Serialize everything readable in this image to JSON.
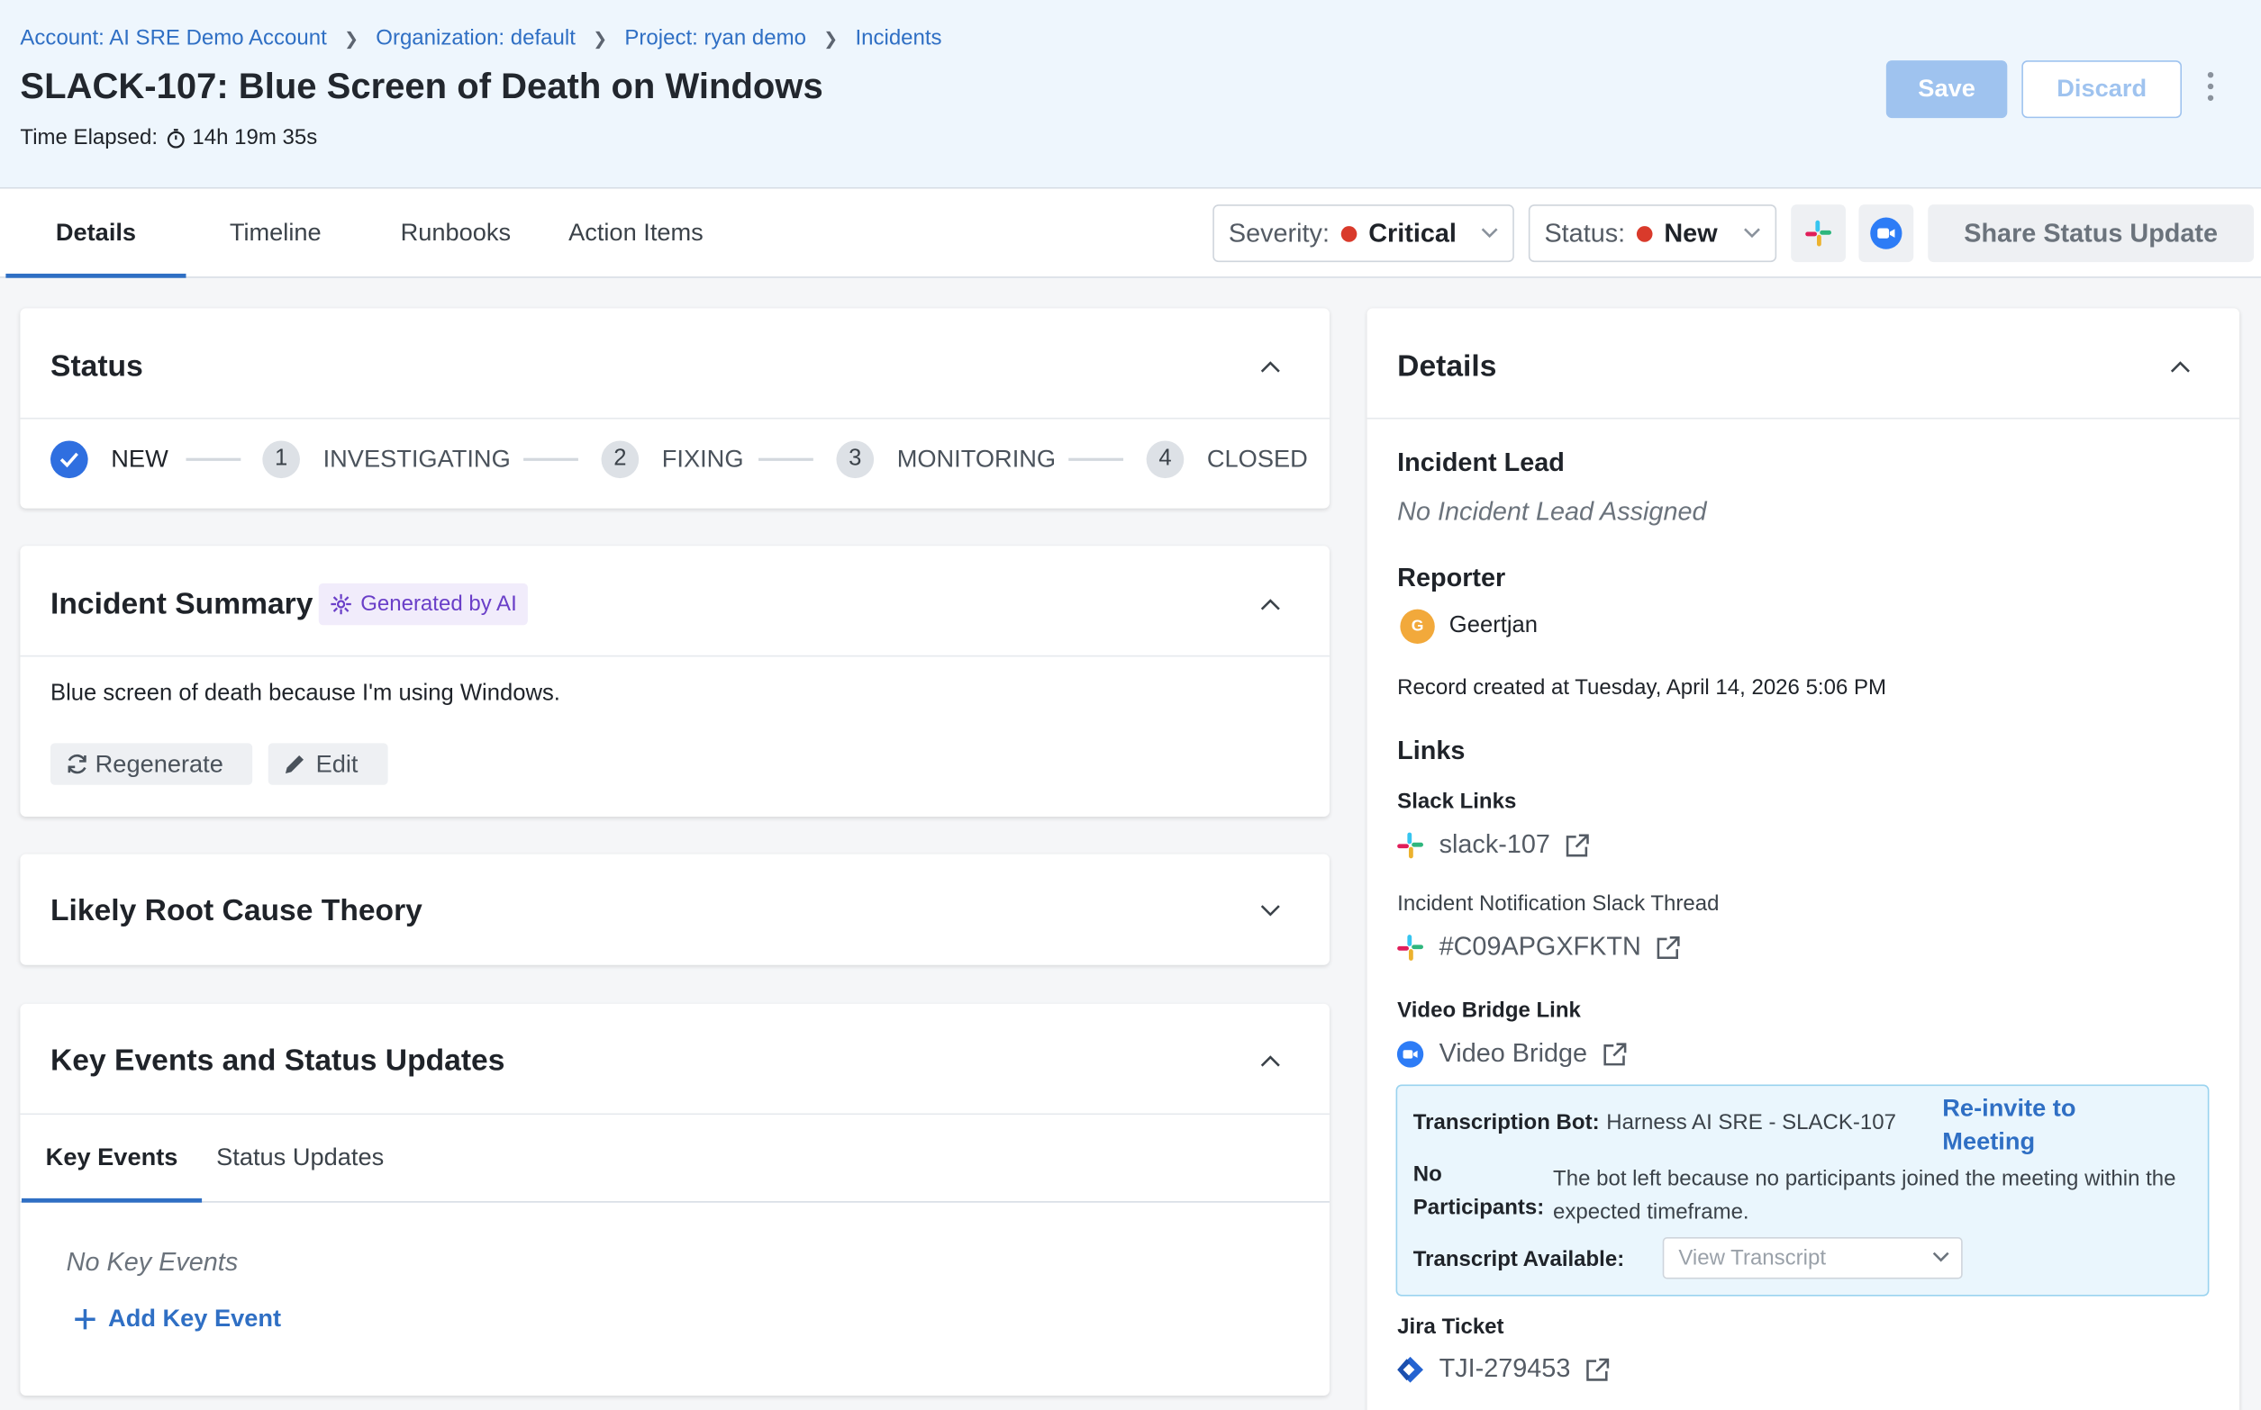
{
  "breadcrumb": [
    "Account: AI SRE Demo Account",
    "Organization: default",
    "Project: ryan demo",
    "Incidents"
  ],
  "incident": {
    "title": "SLACK-107: Blue Screen of Death on Windows",
    "elapsed_label": "Time Elapsed:",
    "elapsed_value": "14h 19m 35s"
  },
  "header_actions": {
    "save": "Save",
    "discard": "Discard"
  },
  "tabs": [
    "Details",
    "Timeline",
    "Runbooks",
    "Action Items"
  ],
  "severity": {
    "label": "Severity:",
    "value": "Critical",
    "color": "#d93a2b"
  },
  "status_dd": {
    "label": "Status:",
    "value": "New",
    "color": "#d93a2b"
  },
  "share_button": "Share Status Update",
  "status_card": {
    "title": "Status",
    "steps": [
      {
        "marker": "",
        "label": "NEW"
      },
      {
        "marker": "1",
        "label": "INVESTIGATING"
      },
      {
        "marker": "2",
        "label": "FIXING"
      },
      {
        "marker": "3",
        "label": "MONITORING"
      },
      {
        "marker": "4",
        "label": "CLOSED"
      }
    ]
  },
  "summary_card": {
    "title": "Incident Summary",
    "badge": "Generated by AI",
    "text": "Blue screen of death because I'm using Windows.",
    "regenerate": "Regenerate",
    "edit": "Edit"
  },
  "root_cause_card": {
    "title": "Likely Root Cause Theory"
  },
  "events_card": {
    "title": "Key Events and Status Updates",
    "subtabs": [
      "Key Events",
      "Status Updates"
    ],
    "empty": "No Key Events",
    "add": "Add Key Event"
  },
  "details_card": {
    "title": "Details",
    "lead_label": "Incident Lead",
    "lead_value": "No Incident Lead Assigned",
    "reporter_label": "Reporter",
    "reporter_initial": "G",
    "reporter_name": "Geertjan",
    "record_created": "Record created at Tuesday, April 14, 2026 5:06 PM",
    "links_label": "Links",
    "slack_links_label": "Slack Links",
    "slack_link": "slack-107",
    "thread_label": "Incident Notification Slack Thread",
    "thread_link": "#C09APGXFKTN",
    "video_label": "Video Bridge Link",
    "video_link": "Video Bridge",
    "bot": {
      "k1": "Transcription Bot:",
      "v1": "Harness AI SRE - SLACK-107",
      "reinvite": "Re-invite to Meeting",
      "k2a": "No",
      "k2b": "Participants:",
      "v2": "The bot left because no participants joined the meeting within the expected timeframe.",
      "k3": "Transcript Available:",
      "select": "View Transcript"
    },
    "jira_label": "Jira Ticket",
    "jira_link": "TJI-279453"
  },
  "colors": {
    "accent": "#2f6fc4",
    "header_bg": "#eef6fd",
    "ai_purple": "#6a3fc8"
  }
}
